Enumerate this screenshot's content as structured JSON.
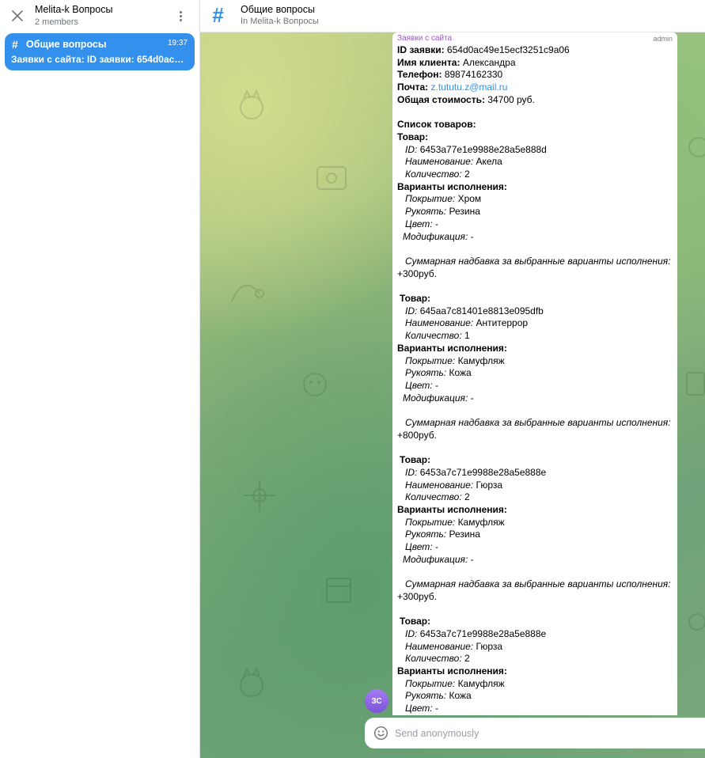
{
  "sidebar": {
    "group_title": "Melita-k Вопросы",
    "members": "2 members",
    "topics": [
      {
        "hash": "#",
        "name": "Общие вопросы",
        "time": "19:37",
        "preview": "Заявки с сайта: ID заявки: 654d0ac49e15ecf3251c9a06"
      }
    ]
  },
  "header": {
    "hash": "#",
    "title": "Общие вопросы",
    "subtitle": "In Melita-k Вопросы"
  },
  "message": {
    "sender": "Заявки с сайта",
    "admin": "admin",
    "order_id_label": "ID заявки:",
    "order_id": "654d0ac49e15ecf3251c9a06",
    "client_label": "Имя клиента:",
    "client": "Александра",
    "phone_label": "Телефон:",
    "phone": "89874162330",
    "email_label": "Почта:",
    "email": "z.tututu.z@mail.ru",
    "total_label": "Общая стоимость:",
    "total": "34700 руб.",
    "list_label": "Список товаров:",
    "item_label": "Товар:",
    "variants_label": "Варианты  исполнения:",
    "items": [
      {
        "id_label": "ID:",
        "id": "6453a77e1e9988e28a5e888d",
        "name_label": "Наименование:",
        "name": "Акела",
        "qty_label": "Количество:",
        "qty": "2",
        "cover_label": "Покрытие:",
        "cover": "Хром",
        "handle_label": "Рукоять:",
        "handle": "Резина",
        "color_label": "Цвет:",
        "color": "-",
        "mod_label": "Модификация:",
        "mod": "-",
        "surcharge_label": "Суммарная надбавка за выбранные варианты исполнения:",
        "surcharge": "+300руб."
      },
      {
        "id_label": "ID:",
        "id": "645aa7c81401e8813e095dfb",
        "name_label": "Наименование:",
        "name": "Антитеррор",
        "qty_label": "Количество:",
        "qty": "1",
        "cover_label": "Покрытие:",
        "cover": "Камуфляж",
        "handle_label": "Рукоять:",
        "handle": "Кожа",
        "color_label": "Цвет:",
        "color": "-",
        "mod_label": "Модификация:",
        "mod": "-",
        "surcharge_label": "Суммарная надбавка за выбранные варианты исполнения:",
        "surcharge": "+800руб."
      },
      {
        "id_label": "ID:",
        "id": "6453a7c71e9988e28a5e888e",
        "name_label": "Наименование:",
        "name": "Гюрза",
        "qty_label": "Количество:",
        "qty": "2",
        "cover_label": "Покрытие:",
        "cover": "Камуфляж",
        "handle_label": "Рукоять:",
        "handle": "Резина",
        "color_label": "Цвет:",
        "color": "-",
        "mod_label": "Модификация:",
        "mod": "-",
        "surcharge_label": "Суммарная надбавка за выбранные варианты исполнения:",
        "surcharge": "+300руб."
      },
      {
        "id_label": "ID:",
        "id": "6453a7c71e9988e28a5e888e",
        "name_label": "Наименование:",
        "name": "Гюрза",
        "qty_label": "Количество:",
        "qty": "2",
        "cover_label": "Покрытие:",
        "cover": "Камуфляж",
        "handle_label": "Рукоять:",
        "handle": "Кожа",
        "color_label": "Цвет:",
        "color": "-"
      }
    ]
  },
  "avatar_initials": "ЗС",
  "composer": {
    "placeholder": "Send anonymously"
  },
  "colors": {
    "accent": "#3390ec",
    "sender": "#9c58c4",
    "avatar": "#8b63e6"
  },
  "icons": {
    "close": "close-icon",
    "more": "more-vertical-icon",
    "topic": "hash-icon",
    "emoji": "smile-icon"
  }
}
